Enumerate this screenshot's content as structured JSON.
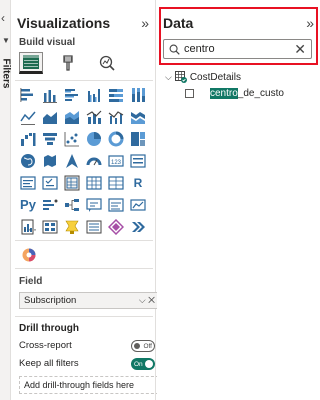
{
  "filters_pane": {
    "label": "Filters"
  },
  "visualizations": {
    "title": "Visualizations",
    "build_visual_label": "Build visual",
    "more": "···",
    "field_label": "Field",
    "field_value": "Subscription",
    "field_actions": "⌵ ✕",
    "drill_through": {
      "title": "Drill through",
      "cross_report": {
        "label": "Cross-report",
        "state": "Off"
      },
      "keep_filters": {
        "label": "Keep all filters",
        "state": "On"
      },
      "add_placeholder": "Add drill-through fields here"
    }
  },
  "data_pane": {
    "title": "Data",
    "search": {
      "value": "centro"
    },
    "tree": {
      "table": "CostDetails",
      "field_match": "centro",
      "field_rest": "_de_custo"
    },
    "highlight_color": "#e81123",
    "match_color": "#117865"
  },
  "icons": {
    "collapse": "»",
    "expand_left": "‹",
    "tree_expand": "⌵",
    "clear": "✕"
  }
}
